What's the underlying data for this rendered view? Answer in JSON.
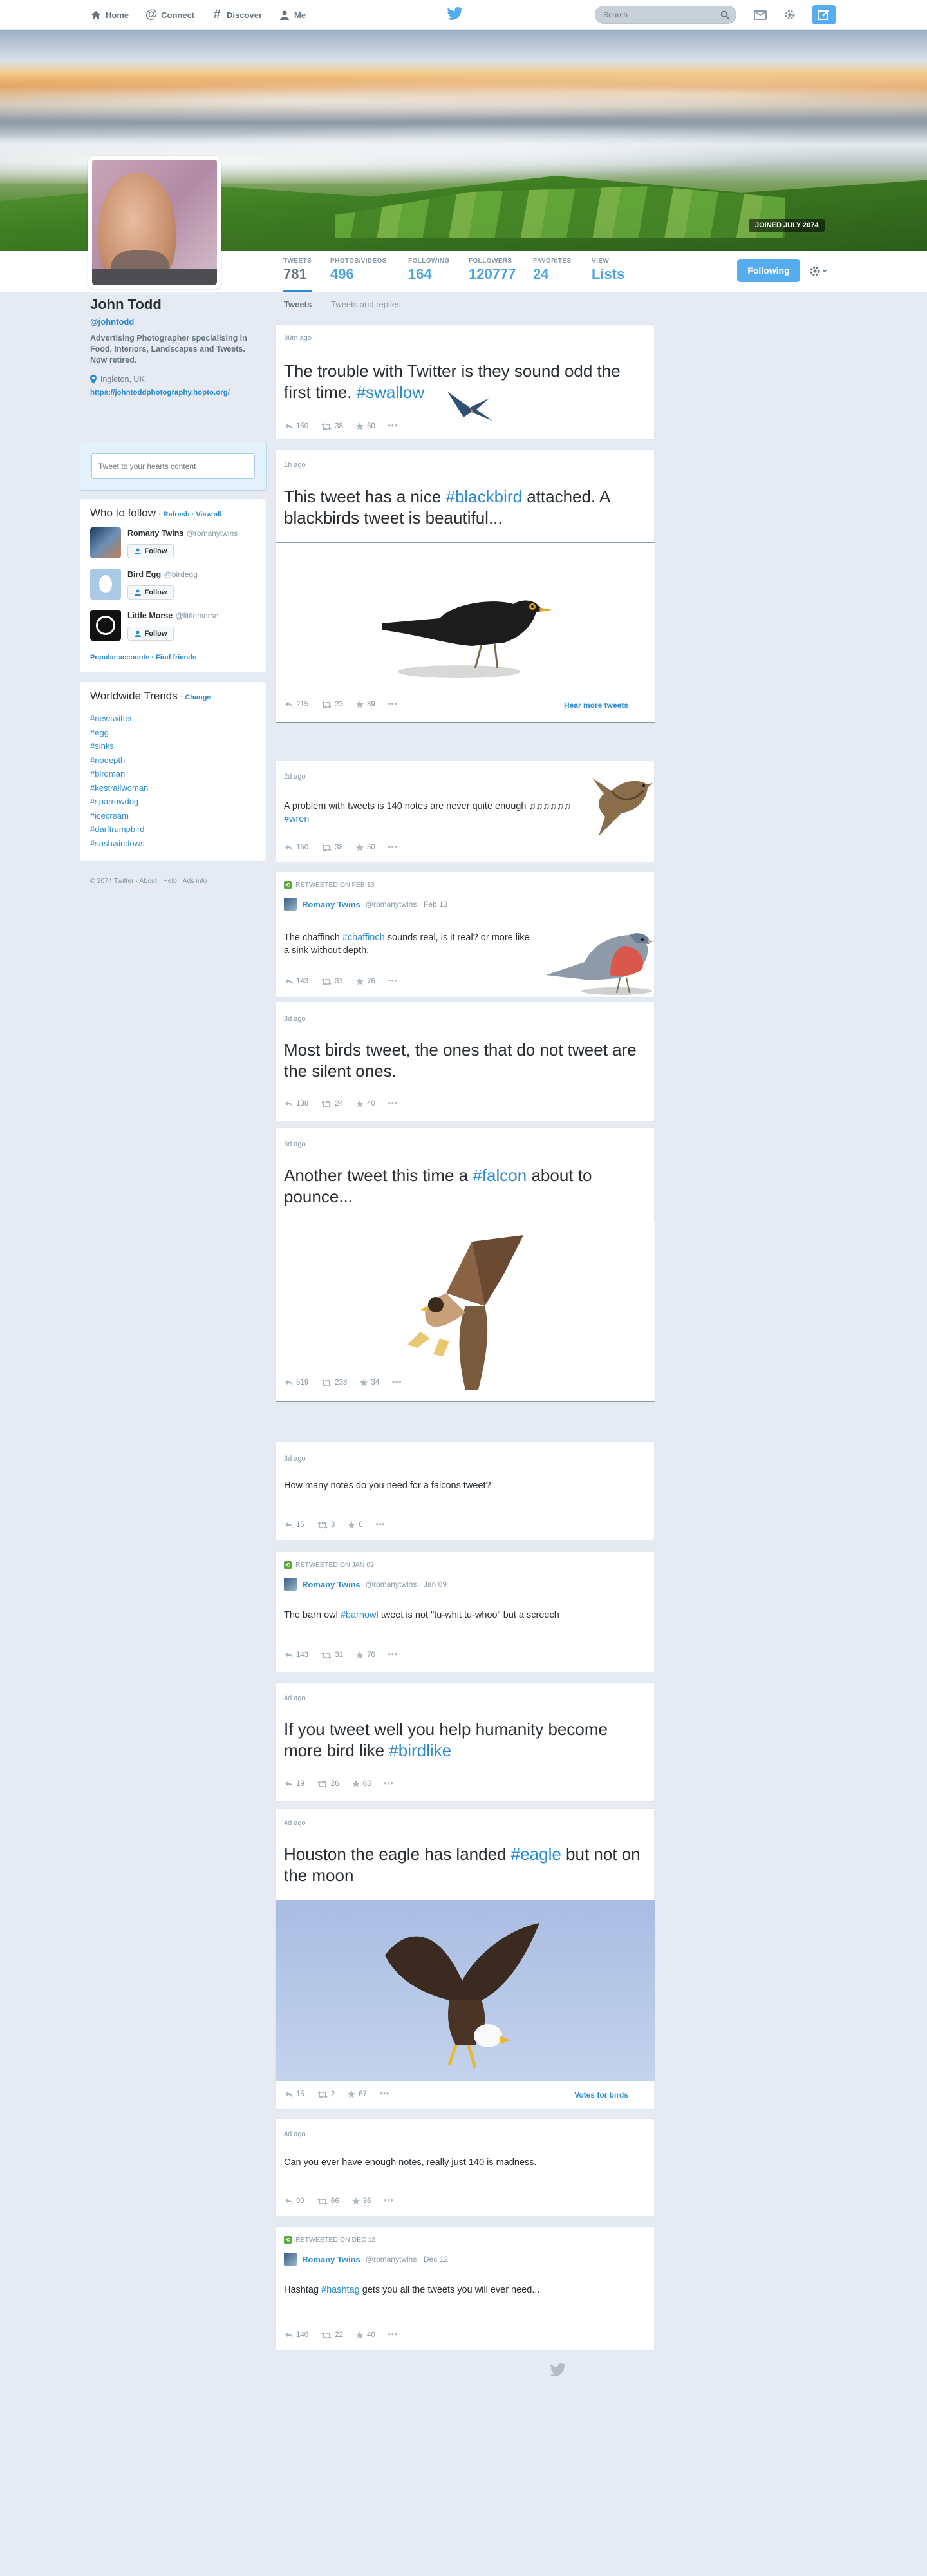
{
  "topbar": {
    "nav": [
      {
        "label": "Home",
        "icon": "home-icon"
      },
      {
        "label": "Connect",
        "icon": "at-icon"
      },
      {
        "label": "Discover",
        "icon": "hash-icon"
      },
      {
        "label": "Me",
        "icon": "person-icon"
      }
    ],
    "search_placeholder": "Search"
  },
  "profile": {
    "joined": "JOINED JULY 2074",
    "name": "John Todd",
    "handle": "@johntodd",
    "bio": "Advertising Photographer specialising in Food, Interiors, Landscapes and Tweets. Now retired.",
    "location": "Ingleton, UK",
    "url": "https://johntoddphotography.hopto.org/"
  },
  "stats": [
    {
      "label": "TWEETS",
      "value": "781"
    },
    {
      "label": "PHOTOS/VIDEOS",
      "value": "496"
    },
    {
      "label": "FOLLOWING",
      "value": "164"
    },
    {
      "label": "FOLLOWERS",
      "value": "120777"
    },
    {
      "label": "FAVORITES",
      "value": "24"
    },
    {
      "label": "VIEW",
      "value": "Lists"
    }
  ],
  "following_button": "Following",
  "tabs": [
    "Tweets",
    "Tweets and replies"
  ],
  "tweetbox_placeholder": "Tweet to your hearts content",
  "who_to_follow": {
    "title": "Who to follow",
    "links": "· Refresh · View all",
    "users": [
      {
        "name": "Romany Twins",
        "handle": "@romanytwins",
        "follow": "Follow"
      },
      {
        "name": "Bird Egg",
        "handle": "@birdegg",
        "follow": "Follow"
      },
      {
        "name": "Little Morse",
        "handle": "@littlemorse",
        "follow": "Follow"
      }
    ],
    "footer": "Popular accounts · Find friends"
  },
  "trends": {
    "title": "Worldwide Trends",
    "change": "· Change",
    "items": [
      "#newtwitter",
      "#egg",
      "#sinks",
      "#nodepth",
      "#birdman",
      "#kestrallwoman",
      "#sparrowdog",
      "#icecream",
      "#darftrumpbird",
      "#sashwindows"
    ]
  },
  "footer": "© 2074 Twitter · About · Help · Ads info",
  "tweets": [
    {
      "time": "38m ago",
      "text": "The trouble with Twitter is they sound odd the first time.",
      "tag": "#swallow",
      "replies": "150",
      "retweets": "38",
      "favorites": "50"
    },
    {
      "time": "1h ago",
      "text_a": "This tweet has a nice",
      "tag": "#blackbird",
      "text_b": "attached. A blackbirds tweet is beautiful...",
      "replies": "215",
      "retweets": "23",
      "favorites": "89",
      "link": "Hear more tweets"
    },
    {
      "time": "2d ago",
      "text": "A problem with tweets is 140 notes are never quite enough",
      "notes": "♫♫♫♫♫♫",
      "tag": "#wren",
      "replies": "150",
      "retweets": "38",
      "favorites": "50"
    },
    {
      "retweeted": "RETWEETED ON FEB 13",
      "author": "Romany Twins",
      "author_handle": "@romanytwins · Feb 13",
      "text_a": "The chaffinch",
      "tag": "#chaffinch",
      "text_b": "sounds real, is it real? or more like a sink without depth.",
      "replies": "143",
      "retweets": "31",
      "favorites": "76"
    },
    {
      "time": "3d ago",
      "text": "Most birds tweet, the ones that do not tweet are the silent ones.",
      "replies": "138",
      "retweets": "24",
      "favorites": "40"
    },
    {
      "time": "3d ago",
      "text_a": "Another tweet this time a",
      "tag": "#falcon",
      "text_b": "about to pounce...",
      "replies": "519",
      "retweets": "238",
      "favorites": "34"
    },
    {
      "time": "3d ago",
      "text": "How many notes do you need for a falcons tweet?",
      "replies": "15",
      "retweets": "3",
      "favorites": "0"
    },
    {
      "retweeted": "RETWEETED ON JAN 09",
      "author": "Romany Twins",
      "author_handle": "@romanytwins · Jan 09",
      "text_a": "The barn owl",
      "tag": "#barnowl",
      "text_b": "tweet is not \"tu-whit tu-whoo\" but a screech",
      "replies": "143",
      "retweets": "31",
      "favorites": "76"
    },
    {
      "time": "4d ago",
      "text_a": "If you tweet well you help humanity become more bird like",
      "tag": "#birdlike",
      "replies": "19",
      "retweets": "26",
      "favorites": "63"
    },
    {
      "time": "4d ago",
      "text_a": "Houston the eagle has landed",
      "tag": "#eagle",
      "text_b": "but not on the moon",
      "replies": "15",
      "retweets": "2",
      "favorites": "67",
      "link": "Votes for birds"
    },
    {
      "time": "4d ago",
      "text": "Can you ever have enough notes, really just 140 is madness.",
      "replies": "90",
      "retweets": "66",
      "favorites": "36"
    },
    {
      "retweeted": "RETWEETED ON DEC 12",
      "author": "Romany Twins",
      "author_handle": "@romanytwins · Dec 12",
      "text_a": "Hashtag",
      "tag": "#hashtag",
      "text_b": "gets you all the tweets you will ever need...",
      "replies": "140",
      "retweets": "22",
      "favorites": "40"
    }
  ],
  "colors": {
    "accent": "#55acee",
    "link": "#2a8bd0",
    "background": "#e6eaf2"
  }
}
